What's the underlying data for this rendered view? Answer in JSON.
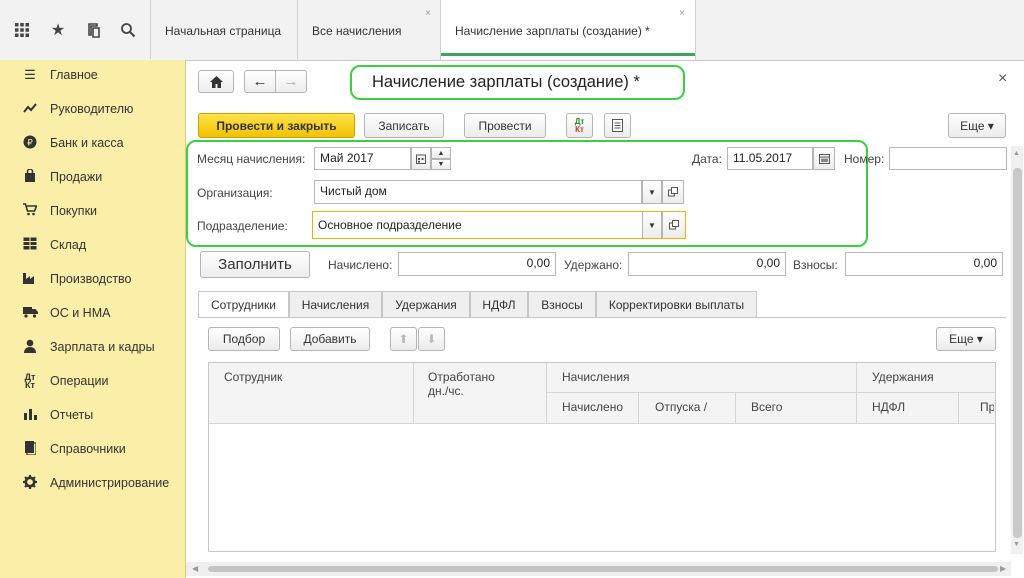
{
  "topbar": {
    "icons": [
      "apps-grid-icon",
      "star-icon",
      "history-icon",
      "search-icon"
    ],
    "tabs": [
      {
        "label": "Начальная страница"
      },
      {
        "label": "Все начисления"
      },
      {
        "label": "Начисление зарплаты (создание) *"
      }
    ]
  },
  "sidebar": {
    "items": [
      {
        "label": "Главное",
        "icon": "menu-icon"
      },
      {
        "label": "Руководителю",
        "icon": "trend-icon"
      },
      {
        "label": "Банк и касса",
        "icon": "ruble-icon"
      },
      {
        "label": "Продажи",
        "icon": "bag-icon"
      },
      {
        "label": "Покупки",
        "icon": "cart-icon"
      },
      {
        "label": "Склад",
        "icon": "warehouse-icon"
      },
      {
        "label": "Производство",
        "icon": "factory-icon"
      },
      {
        "label": "ОС и НМА",
        "icon": "truck-icon"
      },
      {
        "label": "Зарплата и кадры",
        "icon": "person-icon"
      },
      {
        "label": "Операции",
        "icon": "dt-kt-icon"
      },
      {
        "label": "Отчеты",
        "icon": "bar-chart-icon"
      },
      {
        "label": "Справочники",
        "icon": "book-icon"
      },
      {
        "label": "Администрирование",
        "icon": "gear-icon"
      }
    ]
  },
  "form": {
    "title": "Начисление зарплаты (создание) *",
    "close_glyph": "×",
    "buttons": {
      "post_close": "Провести и закрыть",
      "save": "Записать",
      "post": "Провести",
      "more": "Еще ▾",
      "fill": "Заполнить"
    },
    "fields": {
      "month_label": "Месяц начисления:",
      "month_value": "Май 2017",
      "date_label": "Дата:",
      "date_value": "11.05.2017",
      "number_label": "Номер:",
      "number_value": "",
      "org_label": "Организация:",
      "org_value": "Чистый дом",
      "dept_label": "Подразделение:",
      "dept_value": "Основное подразделение"
    },
    "totals": {
      "accrued_label": "Начислено:",
      "accrued_value": "0,00",
      "withheld_label": "Удержано:",
      "withheld_value": "0,00",
      "contrib_label": "Взносы:",
      "contrib_value": "0,00"
    },
    "tabs": [
      "Сотрудники",
      "Начисления",
      "Удержания",
      "НДФЛ",
      "Взносы",
      "Корректировки выплаты"
    ],
    "table_toolbar": {
      "pick": "Подбор",
      "add": "Добавить",
      "more": "Еще ▾"
    },
    "table_header": {
      "employee": "Сотрудник",
      "worked_line1": "Отработано",
      "worked_line2": "дн./чс.",
      "accruals_group": "Начисления",
      "accrued": "Начислено",
      "vacation": "Отпуска /",
      "total": "Всего",
      "deductions_group": "Удержания",
      "ndfl": "НДФЛ",
      "pr": "Пр"
    },
    "colors": {
      "accent_green": "#39d13f",
      "primary_button": "#f2c200",
      "sidebar_bg": "#fbeea8"
    }
  }
}
